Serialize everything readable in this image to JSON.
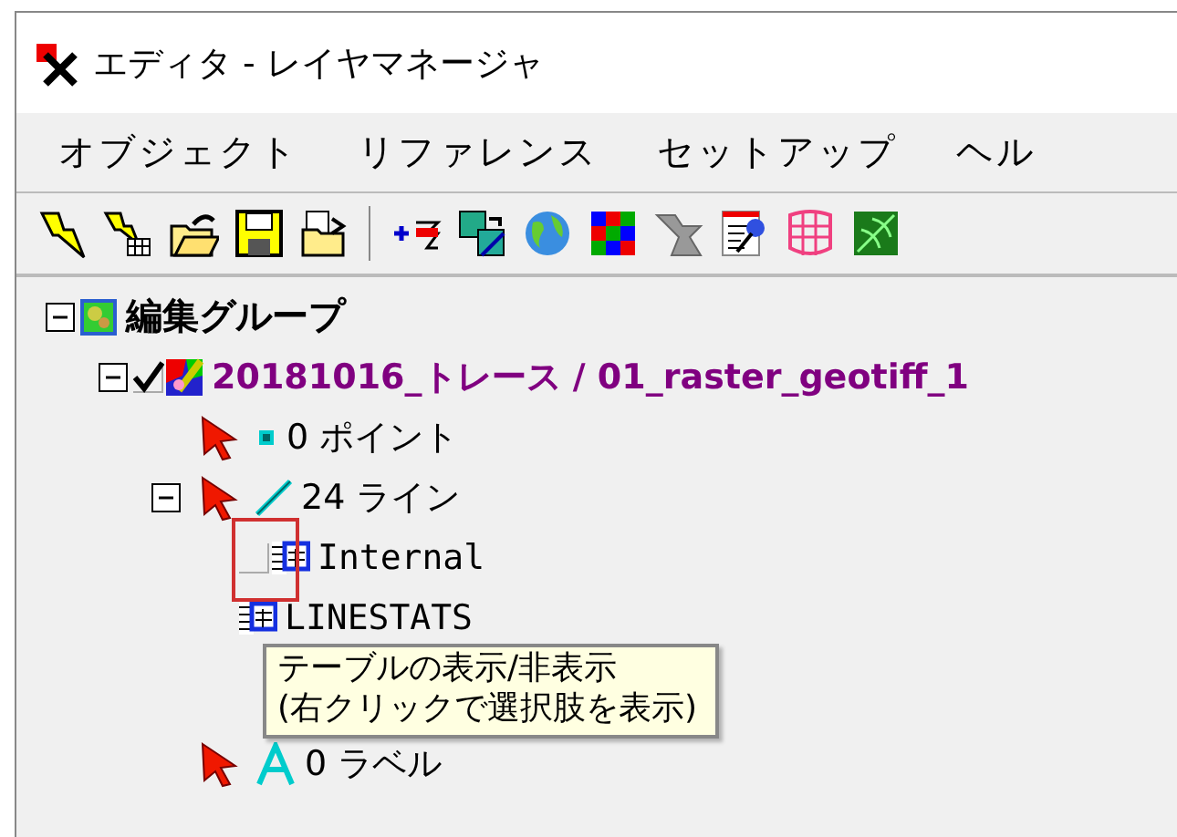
{
  "window": {
    "title": "エディタ - レイヤマネージャ"
  },
  "menu": [
    {
      "label": "オブジェクト"
    },
    {
      "label": "リファレンス"
    },
    {
      "label": "セットアップ"
    },
    {
      "label": "ヘル"
    }
  ],
  "tree": [
    {
      "kind": "group",
      "label": "編集グループ",
      "expanded": true,
      "children": [
        {
          "kind": "layer",
          "label": "20181016_トレース / 01_raster_geotiff_1",
          "expanded": true,
          "checked": true,
          "children": [
            {
              "kind": "points",
              "label": "0 ポイント"
            },
            {
              "kind": "lines",
              "label": "24 ライン",
              "expanded": true,
              "children": [
                {
                  "kind": "table",
                  "label": "Internal",
                  "checked": false,
                  "highlight": true
                },
                {
                  "kind": "table",
                  "label": "LINESTATS"
                }
              ]
            },
            {
              "kind": "labels",
              "label": "0 ラベル"
            }
          ]
        }
      ]
    }
  ],
  "tooltip": {
    "lines": [
      "テーブルの表示/非表示",
      "(右クリックで選択肢を表示)"
    ]
  }
}
